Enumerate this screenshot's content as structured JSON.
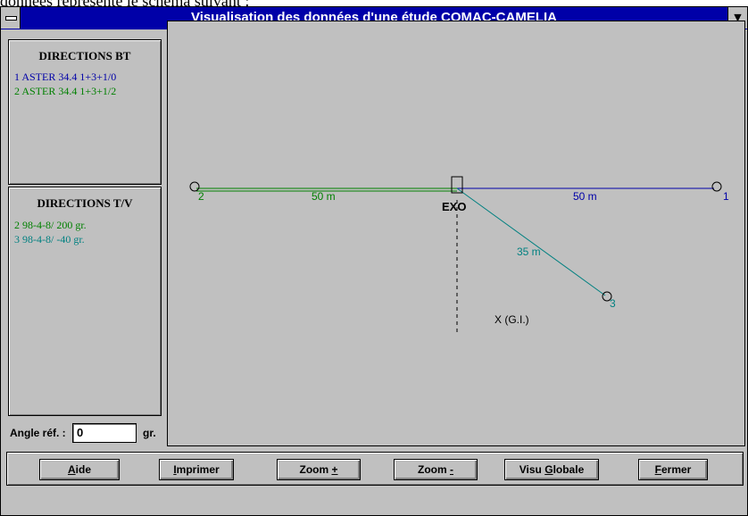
{
  "caption": "données représente le schéma suivant :",
  "window": {
    "title": "Visualisation des données d'une étude COMAC-CAMELIA"
  },
  "panels": {
    "bt": {
      "title": "DIRECTIONS BT",
      "lines": [
        {
          "text": "1  ASTER 34.4 1+3+1/0",
          "color": "#0000a8"
        },
        {
          "text": "2  ASTER 34.4 1+3+1/2",
          "color": "#008000"
        }
      ]
    },
    "tv": {
      "title": "DIRECTIONS T/V",
      "lines": [
        {
          "text": "2  98-4-8/ 200 gr.",
          "color": "#008000"
        },
        {
          "text": "3  98-4-8/ -40 gr.",
          "color": "#008080"
        }
      ]
    }
  },
  "angle": {
    "label": "Angle réf. :",
    "value": "0",
    "unit": "gr."
  },
  "diagram": {
    "colors": {
      "d1": "#0000a8",
      "d2": "#008000",
      "d3": "#008080"
    },
    "origin_label": "EXO",
    "gi_label": "X (G.I.)",
    "directions": [
      {
        "id": "1",
        "length_label": "50 m",
        "color": "#0000a8"
      },
      {
        "id": "2",
        "length_label": "50 m",
        "color": "#008000"
      },
      {
        "id": "3",
        "length_label": "35 m",
        "color": "#008080"
      }
    ]
  },
  "buttons": [
    {
      "before": "",
      "hot": "A",
      "after": "ide"
    },
    {
      "before": "",
      "hot": "I",
      "after": "mprimer"
    },
    {
      "before": "Zoom ",
      "hot": "+",
      "after": ""
    },
    {
      "before": "Zoom ",
      "hot": "-",
      "after": ""
    },
    {
      "before": "Visu ",
      "hot": "G",
      "after": "lobale"
    },
    {
      "before": "",
      "hot": "F",
      "after": "ermer"
    }
  ]
}
